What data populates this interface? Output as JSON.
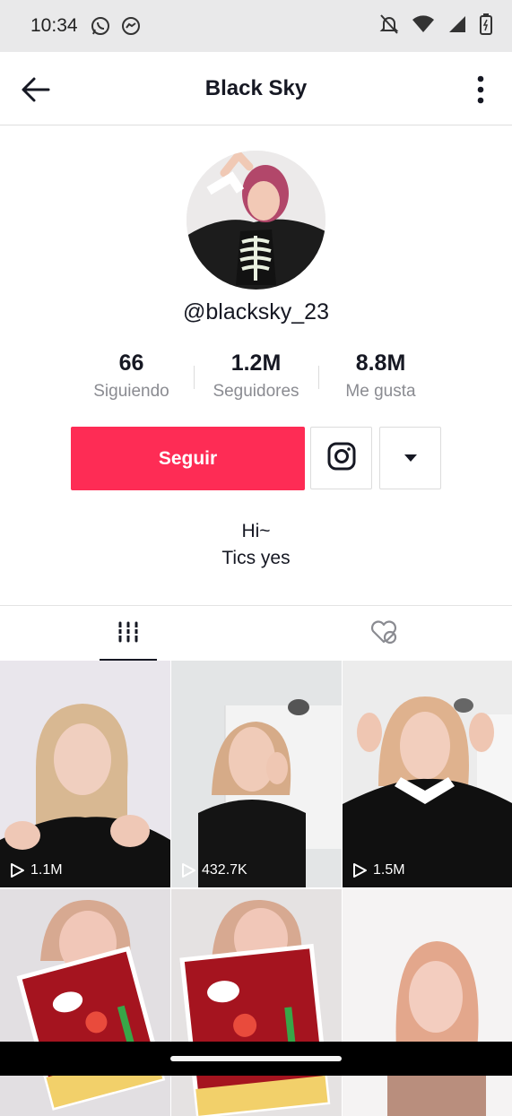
{
  "status_bar": {
    "time": "10:34",
    "left_icons": [
      "whatsapp-icon",
      "messenger-icon"
    ],
    "right_icons": [
      "notifications-off-icon",
      "wifi-icon",
      "signal-icon",
      "battery-icon"
    ]
  },
  "header": {
    "title": "Black Sky",
    "back_icon": "back-arrow-icon",
    "more_icon": "more-vertical-icon"
  },
  "profile": {
    "handle": "@blacksky_23",
    "stats": [
      {
        "value": "66",
        "label": "Siguiendo"
      },
      {
        "value": "1.2M",
        "label": "Seguidores"
      },
      {
        "value": "8.8M",
        "label": "Me gusta"
      }
    ],
    "follow_label": "Seguir",
    "instagram_icon": "instagram-icon",
    "dropdown_icon": "caret-down-icon",
    "bio_lines": [
      "Hi~",
      "Tics yes"
    ]
  },
  "tabs": [
    {
      "icon": "videos-grid-icon",
      "active": true
    },
    {
      "icon": "liked-hidden-icon",
      "active": false
    }
  ],
  "videos": [
    {
      "views": "1.1M"
    },
    {
      "views": "432.7K"
    },
    {
      "views": "1.5M"
    },
    {
      "views": ""
    },
    {
      "views": ""
    },
    {
      "views": ""
    }
  ],
  "colors": {
    "accent": "#fe2c55",
    "text": "#161823",
    "muted": "#8a8b91"
  }
}
